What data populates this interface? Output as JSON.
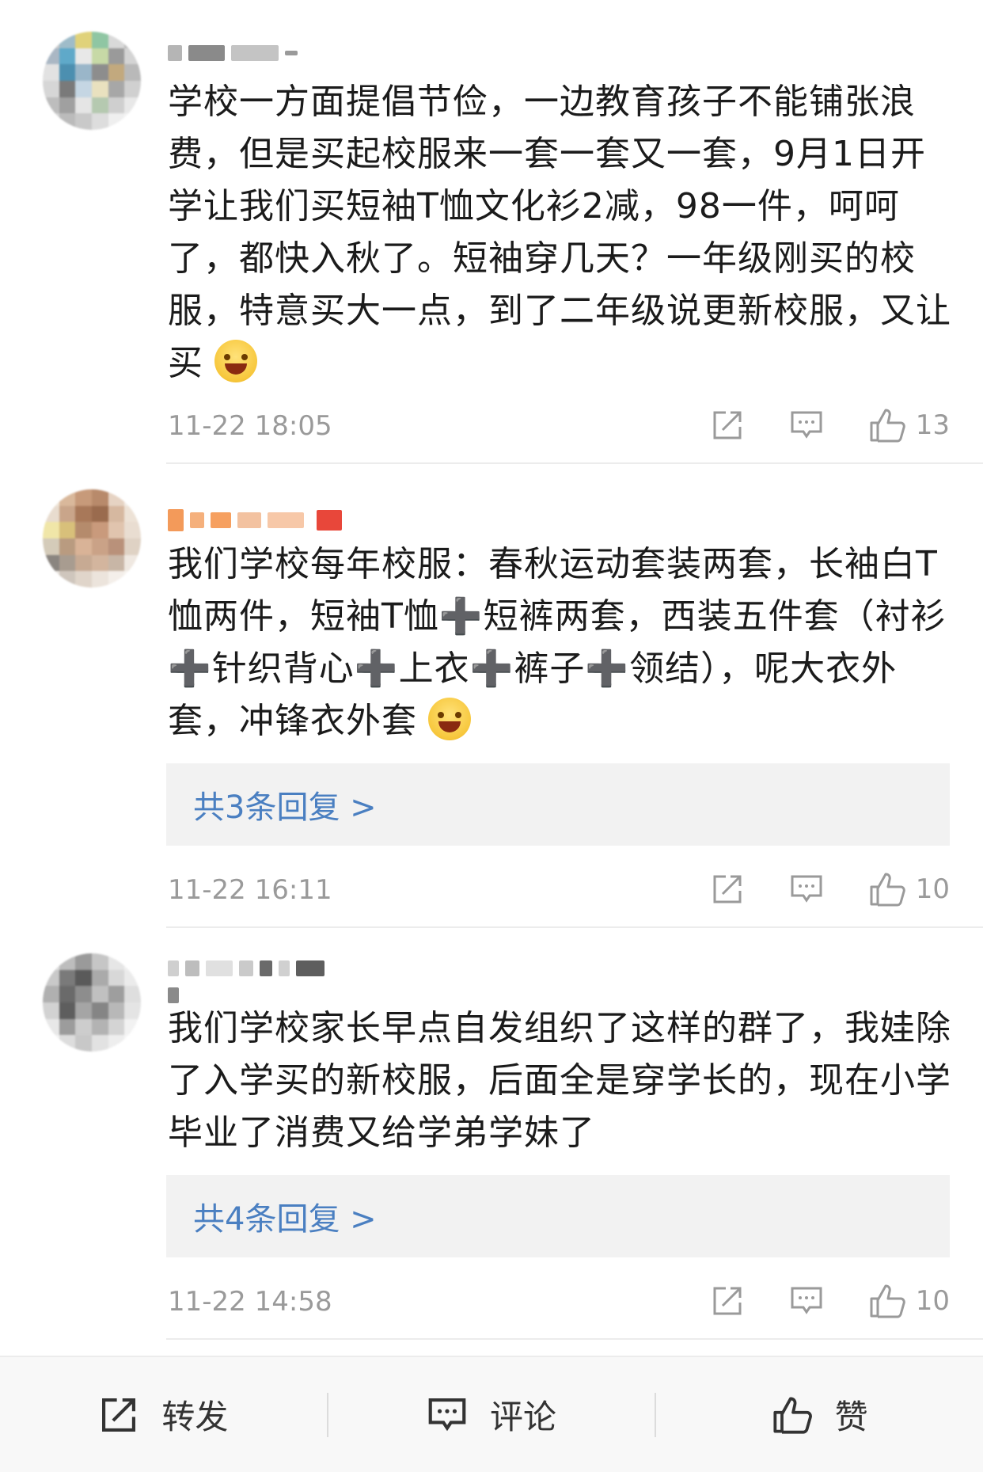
{
  "comments": [
    {
      "text": "学校一方面提倡节俭，一边教育孩子不能铺张浪费，但是买起校服来一套一套又一套，9月1日开学让我们买短袖T恤文化衫2减，98一件，呵呵了，都快入秋了。短袖穿几天？一年级刚买的校服，特意买大一点，到了二年级说更新校服，又让买",
      "emoji": "laughing-tears-emoji",
      "time": "11-22 18:05",
      "likes": "13"
    },
    {
      "text": "我们学校每年校服：春秋运动套装两套，长袖白T恤两件，短袖T恤➕短裤两套，西装五件套（衬衫➕针织背心➕上衣➕裤子➕领结），呢大衣外套，冲锋衣外套",
      "emoji": "crying-laughing-emoji",
      "replies": "共3条回复 >",
      "time": "11-22 16:11",
      "likes": "10"
    },
    {
      "text": "我们学校家长早点自发组织了这样的群了，我娃除了入学买的新校服，后面全是穿学长的，现在小学毕业了消费又给学弟学妹了",
      "replies": "共4条回复 >",
      "time": "11-22 14:58",
      "likes": "10"
    }
  ],
  "bottom_bar": {
    "repost": "转发",
    "comment": "评论",
    "like": "赞"
  },
  "colors": {
    "link": "#4a7fc1",
    "meta": "#9a9a9a",
    "reply_bg": "#f2f2f2"
  }
}
